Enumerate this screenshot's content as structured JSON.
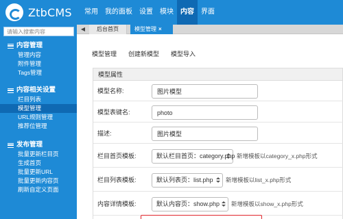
{
  "app": {
    "logo_text": "ZtbCMS"
  },
  "nav": {
    "items": [
      "常用",
      "我的面板",
      "设置",
      "模块",
      "内容",
      "界面"
    ],
    "active_index": 4
  },
  "sidebar": {
    "search_placeholder": "请输入搜索内容",
    "groups": [
      {
        "title": "内容管理",
        "items": [
          "管理内容",
          "附件管理",
          "Tags管理"
        ]
      },
      {
        "title": "内容相关设置",
        "items": [
          "栏目列表",
          "模型管理",
          "URL规则管理",
          "推荐位管理"
        ],
        "active_item": "模型管理"
      },
      {
        "title": "发布管理",
        "items": [
          "批量更新栏目页",
          "生成首页",
          "批量更新URL",
          "批量更新内容页",
          "刷新自定义页面"
        ]
      }
    ]
  },
  "tabs": {
    "back_icon": "chevron-left-icon",
    "home": "后台首页",
    "current": "模型管理",
    "close": "×"
  },
  "subtabs": [
    "模型管理",
    "创建新模型",
    "模型导入"
  ],
  "form": {
    "section_title": "模型属性",
    "name": {
      "label": "模型名称:",
      "value": "图片模型"
    },
    "table_key": {
      "label": "模型表键名:",
      "value": "photo"
    },
    "description": {
      "label": "描述:",
      "value": "图片模型"
    },
    "category_template": {
      "label": "栏目首页模板:",
      "value": "默认栏目首页：category.php",
      "hint": "新增模板以category_x.php形式"
    },
    "list_template": {
      "label": "栏目列表模板:",
      "value": "默认列表页：list.php",
      "hint": "新增模板以list_x.php形式"
    },
    "show_template": {
      "label": "内容详情模板:",
      "value": "默认内容页：show.php",
      "hint": "新增模板以show_x.php形式"
    }
  },
  "colors": {
    "primary": "#1e8ad6",
    "active": "#0f69b3",
    "highlight": "#e0242b"
  }
}
